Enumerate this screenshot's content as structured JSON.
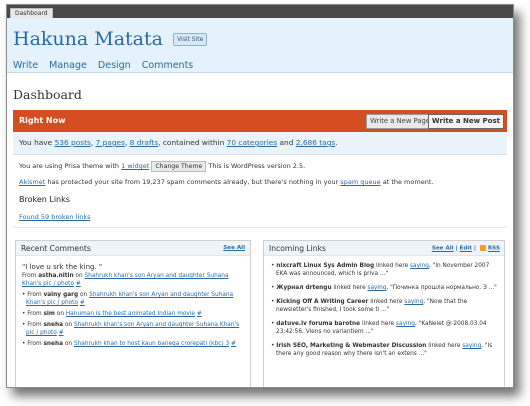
{
  "tab": {
    "label": "Dashboard"
  },
  "header": {
    "site_title": "Hakuna Matata",
    "visit_site": "Visit Site",
    "nav": [
      "Write",
      "Manage",
      "Design",
      "Comments"
    ]
  },
  "page_title": "Dashboard",
  "right_now": {
    "title": "Right Now",
    "write_page": "Write a New Page",
    "write_post": "Write a New Post",
    "stats": {
      "pre": "You have ",
      "posts": "536 posts",
      "pages": "7 pages",
      "drafts": "8 drafts",
      "mid": ", contained within ",
      "categories": "70 categories",
      "and": " and ",
      "tags": "2,686 tags",
      "end": "."
    },
    "theme": {
      "pre": "You are using Prisa theme with ",
      "widget": "1 widget",
      "btn": "Change Theme",
      "post": " This is WordPress version 2.5."
    },
    "akismet": {
      "name": "Akismet",
      "text": " has protected your site from 19,237 spam comments already, but there's nothing in your ",
      "queue": "spam queue",
      "end": " at the moment."
    },
    "broken": {
      "title": "Broken Links",
      "link": "Found 59 broken links"
    }
  },
  "recent_comments": {
    "title": "Recent Comments",
    "see_all": "See All",
    "quote": "\"I love u srk the king. \"",
    "first_from": "From ",
    "first_author": "astha.nitin",
    "first_on": " on ",
    "first_link": "Shahrukh khan's son Aryan and daughter Suhana Khan's pic / photo",
    "hash": "#",
    "items": [
      {
        "from": "From ",
        "author": "vainy garg",
        "on": " on ",
        "link": "Shahrukh khan's son Aryan and daughter Suhana Khan's pic / photo"
      },
      {
        "from": "From ",
        "author": "sim",
        "on": " on ",
        "link": "Hanuman is the best animated Indian movie"
      },
      {
        "from": "From ",
        "author": "sneha",
        "on": " on ",
        "link": "Shahrukh khan's son Aryan and daughter Suhana Khan's pic / photo"
      },
      {
        "from": "From ",
        "author": "sneha",
        "on": " on ",
        "link": "Shahrukh khan to host kaun banega crorepati (kbc) 3"
      }
    ]
  },
  "incoming_links": {
    "title": "Incoming Links",
    "see_all": "See All",
    "sep": " | ",
    "edit": "Edit",
    "rss": "RSS",
    "items": [
      {
        "source": "nixcraft Linux Sys Admin Blog",
        "mid": " linked here ",
        "saying": "saying",
        "text": ", \"In November 2007 EKA was announced, which is priva ...\""
      },
      {
        "source": "Журнал drtengu",
        "mid": " linked here ",
        "saying": "saying",
        "text": ", \"Починка прошла нормально. З ...\""
      },
      {
        "source": "Kicking Off A Writing Career",
        "mid": " linked here ",
        "saying": "saying",
        "text": ", \"Now that the newsletter's finished, I took some ti ...\""
      },
      {
        "source": "datuve.lv foruma barotne",
        "mid": " linked here ",
        "saying": "saying",
        "text": ", \"KaNeiet @ 2008.03.04 23:42:56. Viens no variantiem ...\""
      },
      {
        "source": "Irish SEO, Marketing & Webmaster Discussion",
        "mid": " linked here ",
        "saying": "saying",
        "text": ", \"Is there any good reason why there isn't an extens ...\""
      }
    ]
  }
}
